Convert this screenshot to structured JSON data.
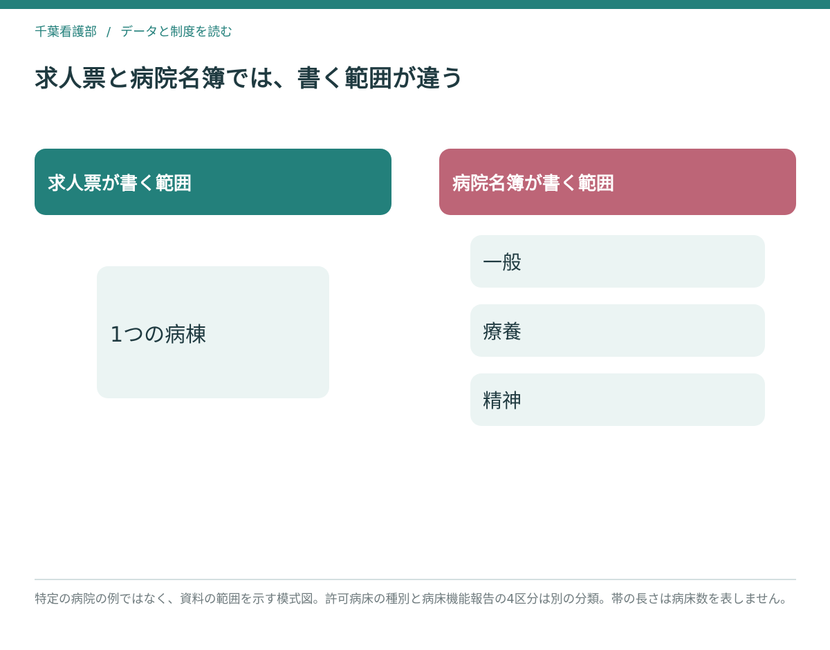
{
  "breadcrumb": {
    "site": "千葉看護部",
    "separator": "/",
    "section": "データと制度を読む"
  },
  "title": "求人票と病院名簿では、書く範囲が違う",
  "columns": {
    "left": {
      "header": "求人票が書く範囲",
      "items": [
        "1つの病棟"
      ]
    },
    "right": {
      "header": "病院名簿が書く範囲",
      "items": [
        "一般",
        "療養",
        "精神"
      ]
    }
  },
  "footnote": "特定の病院の例ではなく、資料の範囲を示す模式図。許可病床の種別と病床機能報告の4区分は別の分類。帯の長さは病床数を表しません。",
  "colors": {
    "teal": "#23807b",
    "rose": "#bd6577",
    "box_bg": "#ebf4f3",
    "text": "#1f3a40"
  }
}
